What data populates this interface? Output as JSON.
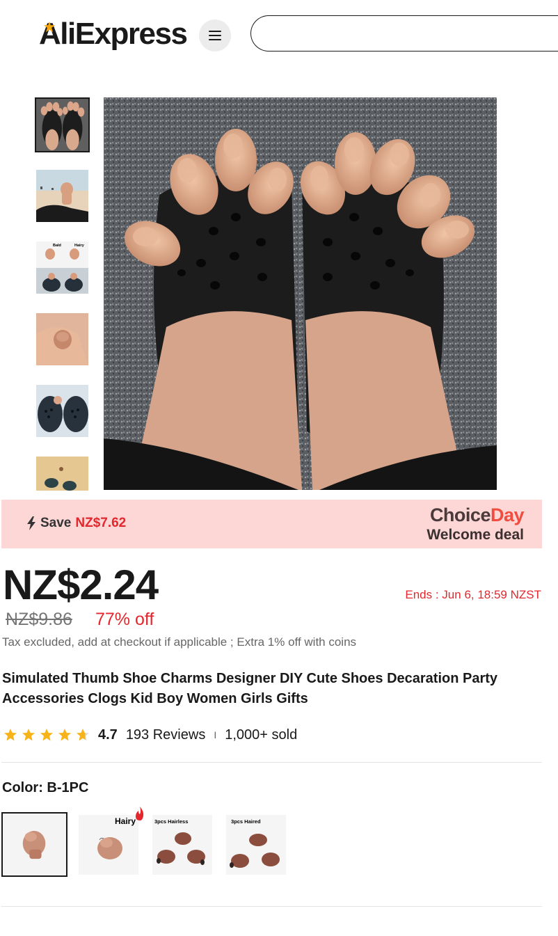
{
  "header": {
    "logo_text": "AliExpress",
    "menu_icon": "hamburger-menu-icon",
    "search_value": "",
    "search_placeholder": ""
  },
  "gallery": {
    "thumbnails": [
      {
        "alt": "Thumb charms on black clogs",
        "active": true
      },
      {
        "alt": "Thumb charm at the beach",
        "active": false
      },
      {
        "alt": "Bald and Hairy comparison",
        "active": false
      },
      {
        "alt": "Thumb charm held in hand",
        "active": false
      },
      {
        "alt": "Thumb charm on clog close-up",
        "active": false
      },
      {
        "alt": "Clogs on sand",
        "active": false
      }
    ],
    "comparison_labels": {
      "left": "Bald",
      "right": "Hairy"
    }
  },
  "promo": {
    "save_label": "Save",
    "save_amount": "NZ$7.62",
    "brand_part1": "Choice",
    "brand_part2": "Day",
    "subtitle": "Welcome deal",
    "colors": {
      "background": "#fdd6d6",
      "accent": "#e3272c"
    }
  },
  "pricing": {
    "current_price": "NZ$2.24",
    "ends_label": "Ends :  Jun 6, 18:59 NZST",
    "original_price": "NZ$9.86",
    "discount": "77% off",
    "tax_note": "Tax excluded, add at checkout if applicable ; Extra 1% off with coins"
  },
  "product": {
    "title": "Simulated Thumb Shoe Charms Designer DIY Cute Shoes Decaration Party Accessories Clogs Kid Boy Women Girls Gifts",
    "rating": 4.7,
    "rating_text": "4.7",
    "reviews": "193 Reviews",
    "separator": "I",
    "sold": "1,000+ sold",
    "star_color": "#f8b319"
  },
  "color_selector": {
    "label": "Color: B-1PC",
    "options": [
      {
        "caption": "",
        "selected": true
      },
      {
        "caption": "Hairy",
        "selected": false
      },
      {
        "caption": "3pcs Hairless",
        "selected": false
      },
      {
        "caption": "3pcs Haired",
        "selected": false
      }
    ]
  }
}
